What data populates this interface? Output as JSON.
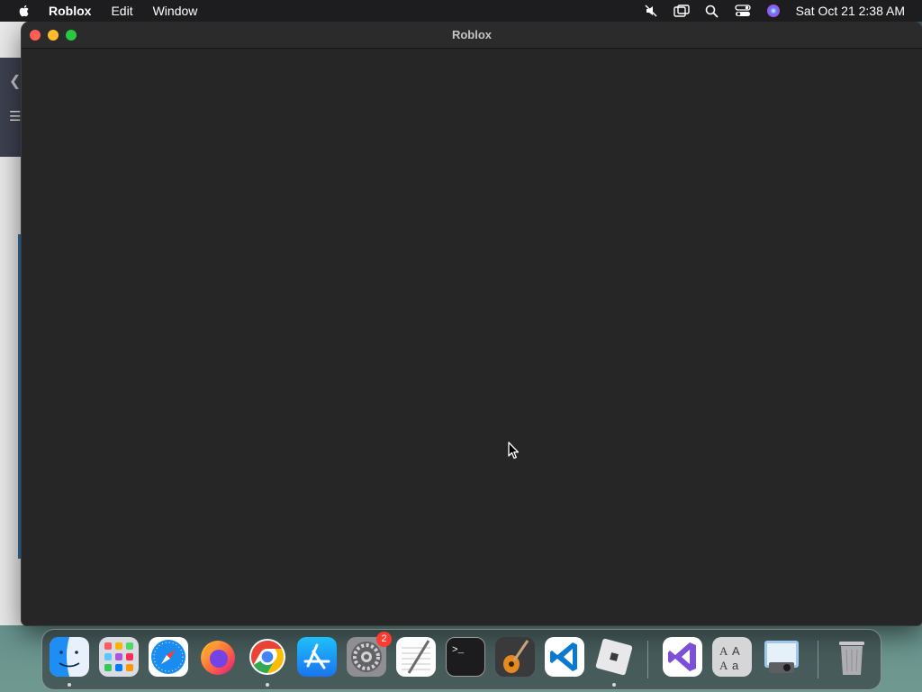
{
  "menubar": {
    "apple_icon": "apple-icon",
    "items": [
      "Roblox",
      "Edit",
      "Window"
    ],
    "status_icons": [
      "mute-icon",
      "screen-mirroring-icon",
      "spotlight-search-icon",
      "control-center-icon",
      "siri-icon"
    ],
    "clock": "Sat Oct 21  2:38 AM"
  },
  "window": {
    "title": "Roblox",
    "buttons": [
      "close",
      "minimize",
      "zoom"
    ],
    "colors": {
      "close": "#ff5f57",
      "minimize": "#febc2e",
      "zoom": "#28c840",
      "background": "#262626"
    }
  },
  "dock": {
    "apps": [
      {
        "name": "Finder",
        "icon": "finder-icon",
        "running": true
      },
      {
        "name": "Launchpad",
        "icon": "launchpad-icon",
        "running": false
      },
      {
        "name": "Safari",
        "icon": "safari-icon",
        "running": false
      },
      {
        "name": "Firefox",
        "icon": "firefox-icon",
        "running": false
      },
      {
        "name": "Google Chrome",
        "icon": "chrome-icon",
        "running": true
      },
      {
        "name": "App Store",
        "icon": "app-store-icon",
        "running": false
      },
      {
        "name": "System Settings",
        "icon": "system-settings-icon",
        "running": false,
        "badge": "2"
      },
      {
        "name": "TextEdit",
        "icon": "textedit-icon",
        "running": false
      },
      {
        "name": "Terminal",
        "icon": "terminal-icon",
        "running": false
      },
      {
        "name": "GarageBand",
        "icon": "garageband-icon",
        "running": false
      },
      {
        "name": "Visual Studio Code",
        "icon": "vscode-icon",
        "running": false
      },
      {
        "name": "Roblox",
        "icon": "roblox-icon",
        "running": true
      },
      {
        "name": "Visual Studio",
        "icon": "visual-studio-icon",
        "running": false
      },
      {
        "name": "Font Book",
        "icon": "font-book-icon",
        "running": false
      },
      {
        "name": "Preview",
        "icon": "preview-icon",
        "running": false
      },
      {
        "name": "Trash",
        "icon": "trash-icon",
        "running": false
      }
    ]
  }
}
